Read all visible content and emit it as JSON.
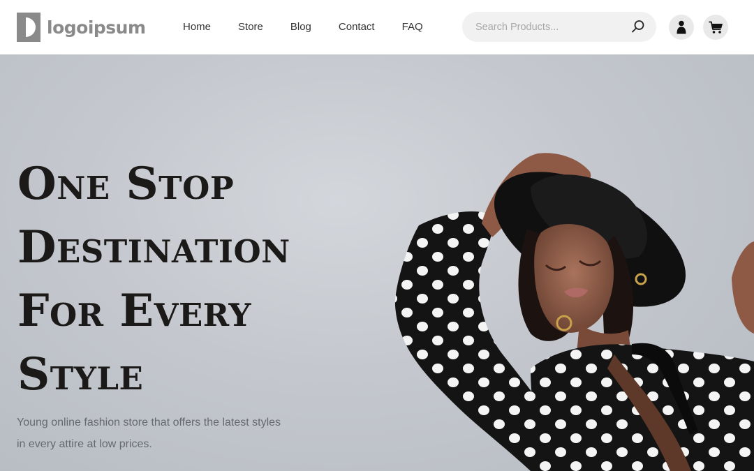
{
  "brand": {
    "name": "logoipsum"
  },
  "nav": {
    "items": [
      {
        "label": "Home"
      },
      {
        "label": "Store"
      },
      {
        "label": "Blog"
      },
      {
        "label": "Contact"
      },
      {
        "label": "FAQ"
      }
    ]
  },
  "search": {
    "placeholder": "Search Products...",
    "value": "",
    "icon": "search-icon"
  },
  "actions": {
    "user_icon": "user-icon",
    "cart_icon": "cart-icon"
  },
  "hero": {
    "headline_lines": [
      "One Stop",
      "Destination",
      "For Every",
      "Style"
    ],
    "subtext": "Young online fashion store that offers the latest styles in every attire at low prices.",
    "image": "woman-polka-dot-dress-black-hat"
  },
  "colors": {
    "header_bg": "#ffffff",
    "hero_bg": "#c4c8ce",
    "headline": "#1c1a18",
    "logo": "#8a8a8a",
    "icon_bg": "#e9e9e9"
  }
}
